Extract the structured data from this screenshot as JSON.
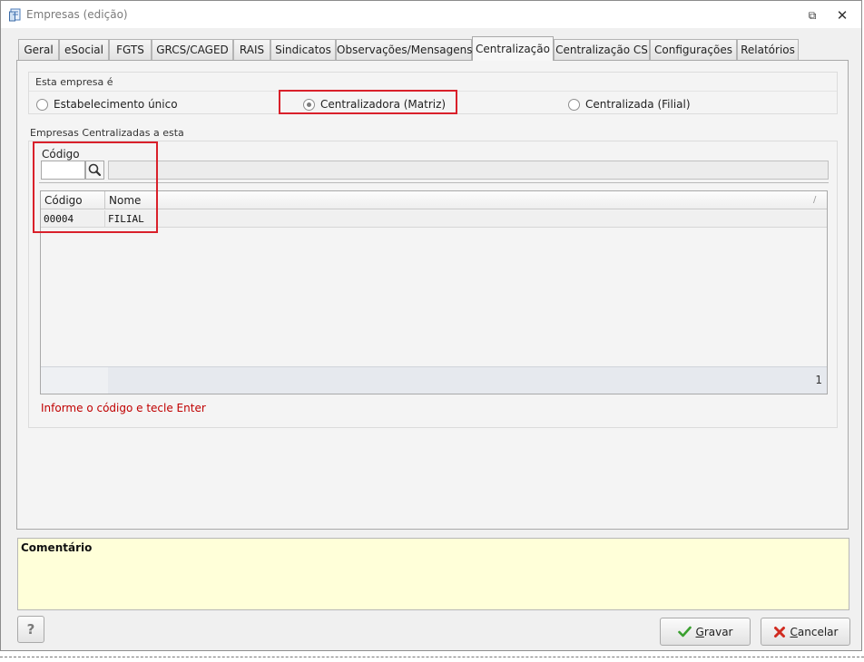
{
  "window": {
    "title": "Empresas (edição)",
    "restore_glyph": "⧉",
    "close_glyph": "✕"
  },
  "tabs": [
    {
      "label": "Geral",
      "active": false
    },
    {
      "label": "eSocial",
      "active": false
    },
    {
      "label": "FGTS",
      "active": false
    },
    {
      "label": "GRCS/CAGED",
      "active": false
    },
    {
      "label": "RAIS",
      "active": false
    },
    {
      "label": "Sindicatos",
      "active": false
    },
    {
      "label": "Observações/Mensagens",
      "active": false
    },
    {
      "label": "Centralização",
      "active": true
    },
    {
      "label": "Centralização CS",
      "active": false
    },
    {
      "label": "Configurações",
      "active": false
    },
    {
      "label": "Relatórios",
      "active": false
    }
  ],
  "empresa_tipo": {
    "title": "Esta empresa é",
    "options": [
      {
        "label": "Estabelecimento único",
        "checked": false
      },
      {
        "label": "Centralizadora (Matriz)",
        "checked": true
      },
      {
        "label": "Centralizada (Filial)",
        "checked": false
      }
    ]
  },
  "centralizadas": {
    "title": "Empresas Centralizadas a esta",
    "codigo_label": "Código",
    "codigo_value": "",
    "nome_value": "",
    "columns": [
      "Código",
      "Nome"
    ],
    "sort_glyph": "/",
    "rows": [
      {
        "codigo": "00004",
        "nome": "FILIAL"
      }
    ],
    "count": "1",
    "hint": "Informe o código e tecle Enter"
  },
  "comment": {
    "label": "Comentário"
  },
  "footer": {
    "help_label": "?",
    "save_label_underlined": "G",
    "save_label_rest": "ravar",
    "cancel_label_underlined": "C",
    "cancel_label_rest": "ancelar"
  },
  "colors": {
    "highlight_box": "#d9202a",
    "hint_text": "#c00000",
    "comment_bg": "#ffffd9"
  }
}
